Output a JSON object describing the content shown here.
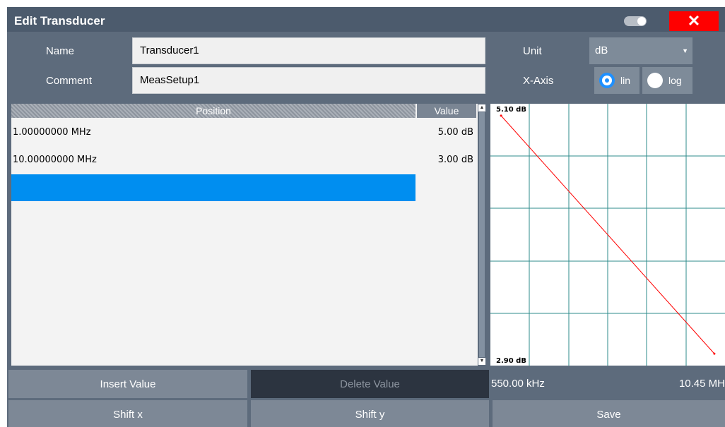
{
  "dialog": {
    "title": "Edit Transducer",
    "close_symbol": "✕"
  },
  "form": {
    "name_label": "Name",
    "name_value": "Transducer1",
    "comment_label": "Comment",
    "comment_value": "MeasSetup1",
    "unit_label": "Unit",
    "unit_value": "dB",
    "xaxis_label": "X-Axis",
    "xaxis_options": [
      "lin",
      "log"
    ],
    "xaxis_selected": "lin"
  },
  "table": {
    "headers": [
      "Position",
      "Value"
    ],
    "rows": [
      {
        "position": "1.00000000 MHz",
        "value": "5.00 dB"
      },
      {
        "position": "10.00000000 MHz",
        "value": "3.00 dB"
      }
    ]
  },
  "chart_data": {
    "type": "line",
    "x": [
      1.0,
      10.0
    ],
    "x_unit": "MHz",
    "values": [
      5.0,
      3.0
    ],
    "ylim": [
      2.9,
      5.1
    ],
    "xlim": [
      0.55,
      10.45
    ],
    "y_top_label": "5.10 dB",
    "y_bottom_label": "2.90 dB",
    "x_start_label": "550.00 kHz",
    "x_end_label": "10.45 MH",
    "grid": true,
    "grid_color": "#2e8b8b",
    "line_color": "#ff0000"
  },
  "buttons": {
    "insert_value": "Insert Value",
    "delete_value": "Delete Value",
    "shift_x": "Shift x",
    "shift_y": "Shift y",
    "save": "Save"
  },
  "icons": {
    "scroll_up": "▲",
    "scroll_down": "▼",
    "dropdown_caret": "▼"
  },
  "colors": {
    "close_button": "#ff0000",
    "selection": "#008ef0",
    "accent": "#1e90ff"
  }
}
